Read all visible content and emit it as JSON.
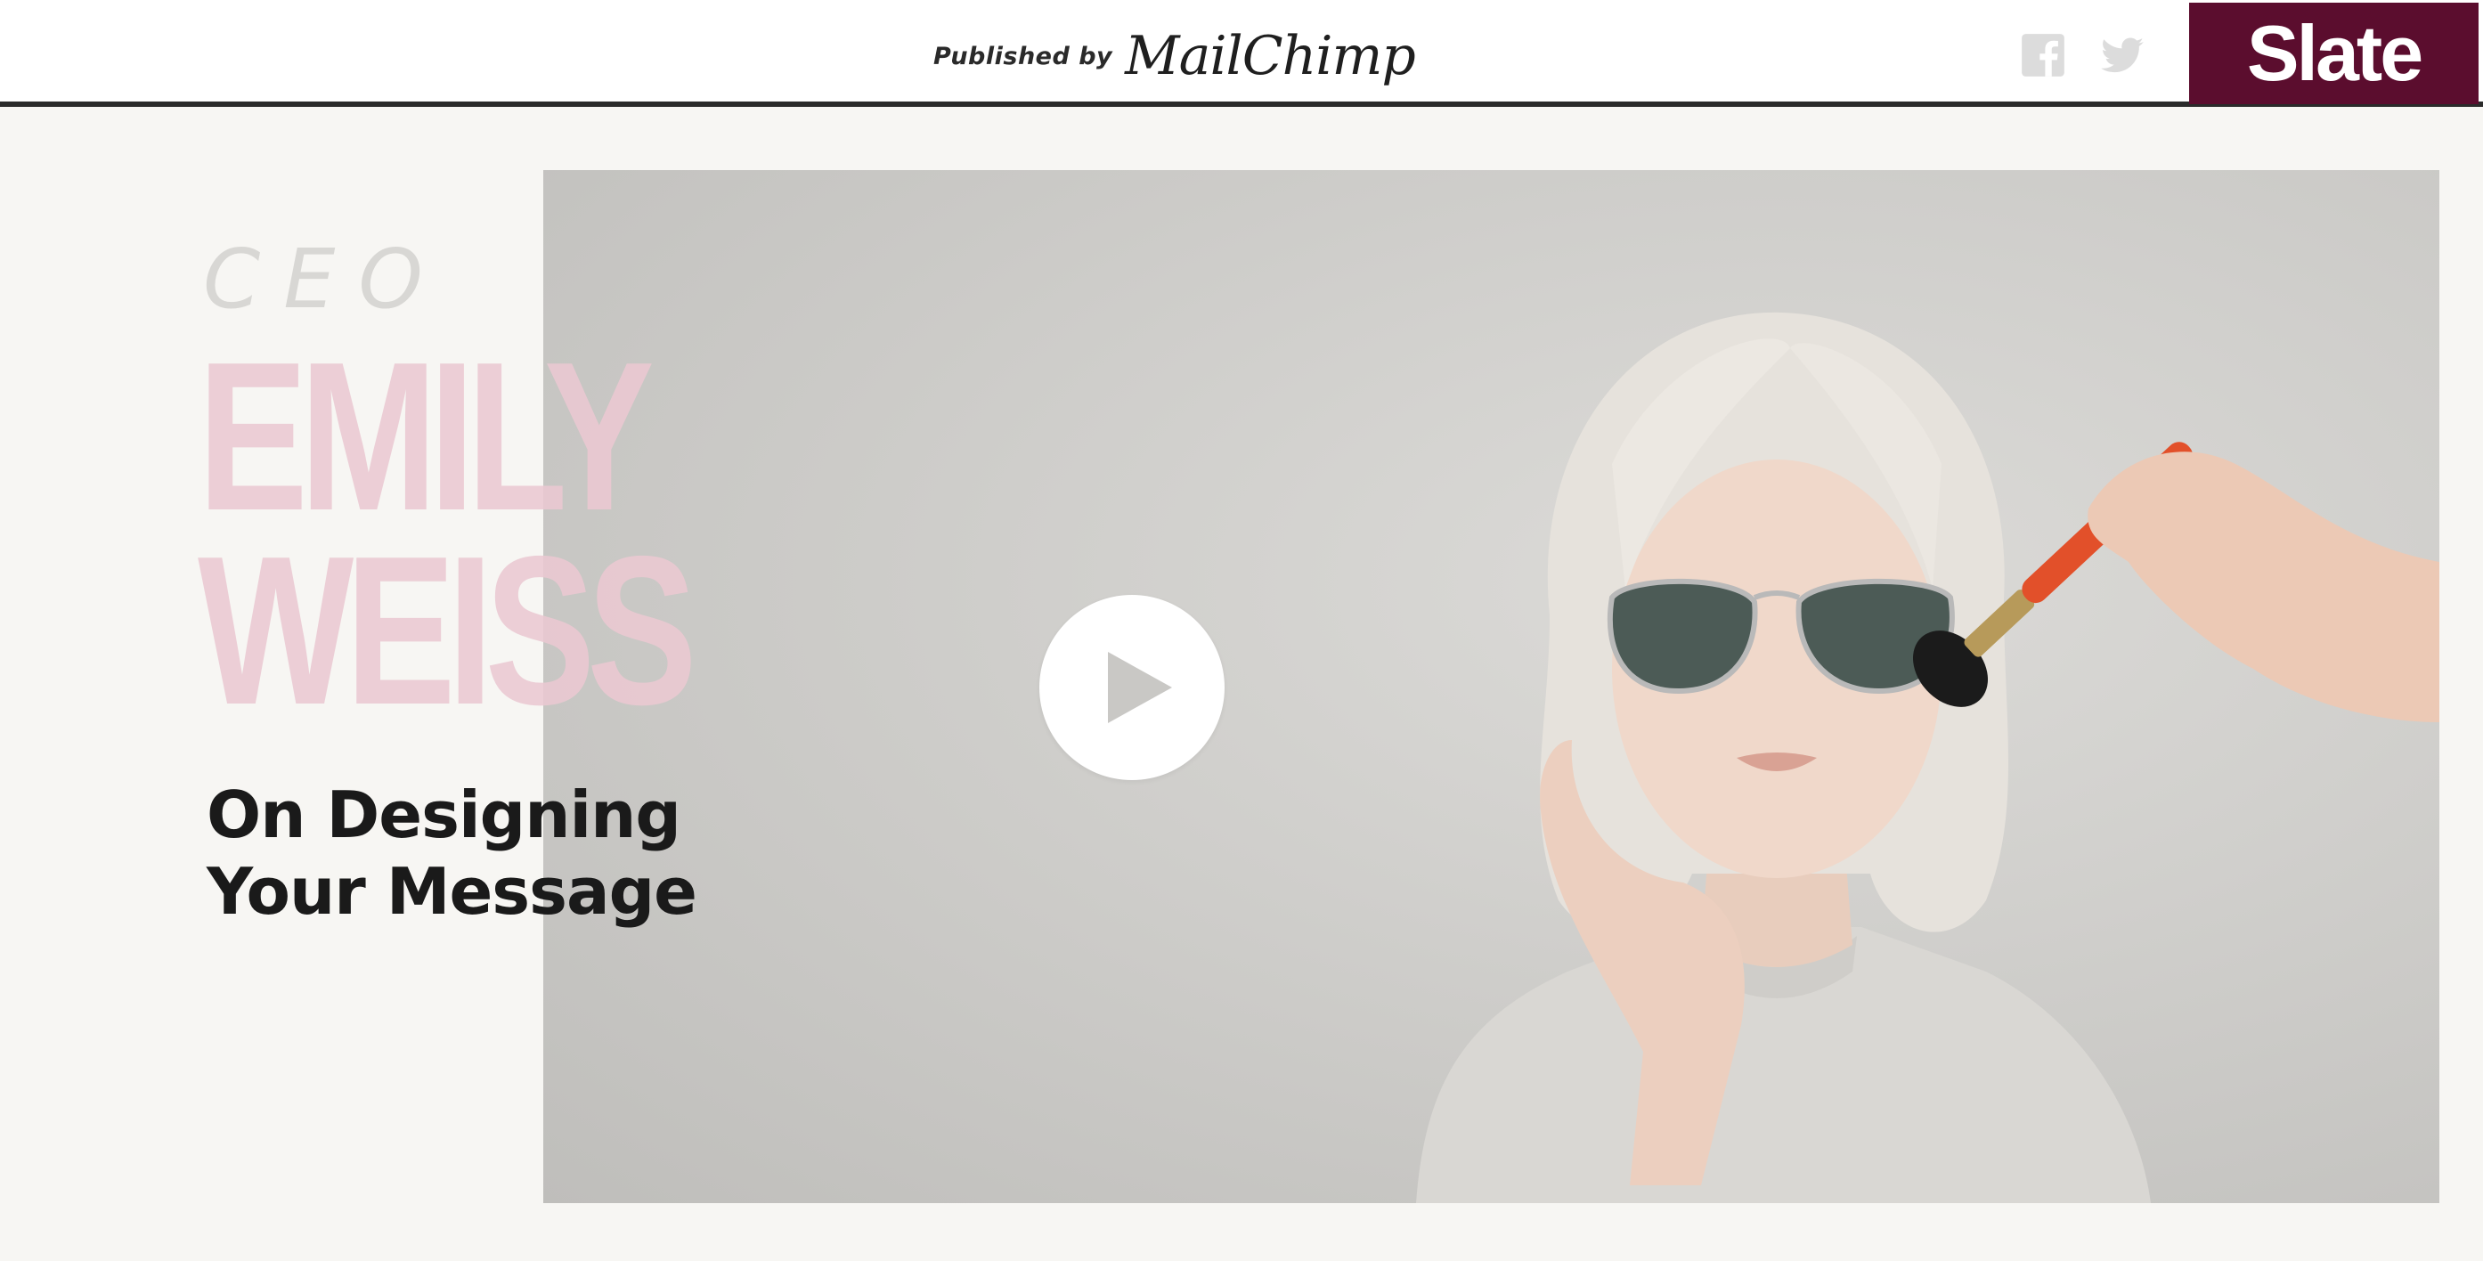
{
  "header": {
    "sponsor_prefix": "Published by",
    "sponsor_brand": "MailChimp",
    "social": [
      {
        "icon": "facebook-icon"
      },
      {
        "icon": "twitter-icon"
      }
    ],
    "site_logo": "Slate",
    "colors": {
      "logo_bg": "#5b0d2e",
      "rule": "#2b2b2b"
    }
  },
  "hero": {
    "role": "CEO",
    "name_first": "EMILY",
    "name_last": "WEISS",
    "subtitle_line1": "On Designing",
    "subtitle_line2": "Your Message",
    "play_icon": "play-icon",
    "colors": {
      "name": "#eac8d2",
      "role": "#d8d7d4",
      "subtitle": "#1a1a1a"
    }
  }
}
